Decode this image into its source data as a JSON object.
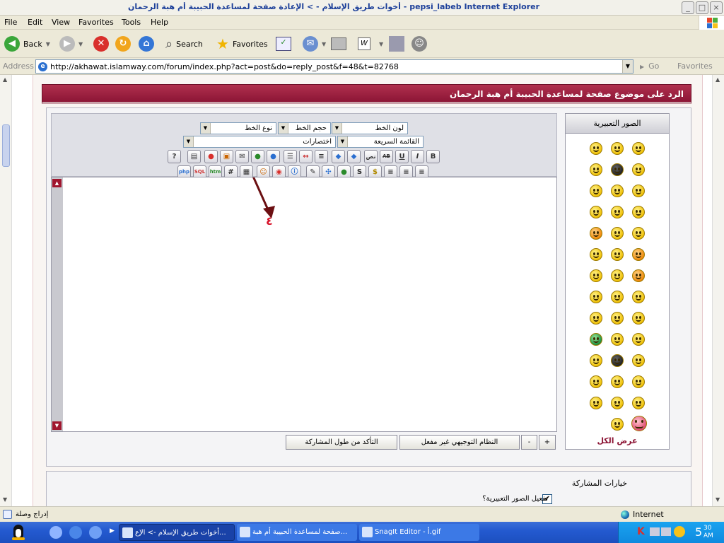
{
  "window": {
    "title": "أخوات طريق الإسلام - > الإعادة صفحة لمساعدة الحبيبة أم هبة الرحمان - pepsi_labeb Internet Explorer"
  },
  "menu": [
    "File",
    "Edit",
    "View",
    "Favorites",
    "Tools",
    "Help"
  ],
  "toolbar": {
    "back": "Back",
    "search": "Search",
    "favorites": "Favorites"
  },
  "address": {
    "label": "Address",
    "url": "http://akhawat.islamway.com/forum/index.php?act=post&do=reply_post&f=48&t=82768",
    "go": "Go",
    "favorites": "Favorites"
  },
  "forum": {
    "title": "الرد على موضوع صفحة لمساعدة الحبيبة أم هبة الرحمان"
  },
  "editor": {
    "selects": {
      "font_color": "لون الخط",
      "font_size": "حجم الخط",
      "font_type": "نوع الخط",
      "quick_list": "القائمة السريعة",
      "shortcuts": "اختصارات"
    },
    "row1_buttons": [
      "B",
      "I",
      "U",
      "AB",
      "نص",
      "",
      "",
      "",
      "",
      "",
      "",
      "",
      "",
      "",
      "",
      "?"
    ],
    "row2_buttons": [
      "",
      "",
      "",
      "S",
      "",
      "",
      "",
      "",
      "",
      "",
      "",
      "#",
      "htm",
      "SQL",
      "php"
    ],
    "annotation_label": "٤",
    "buttons": {
      "plus": "+",
      "minus": "-",
      "guided_mode": "النظام التوجيهي غير مفعل",
      "check_length": "التأكد من طول المشاركة"
    }
  },
  "emoticons": {
    "header": "الصور التعبيرية",
    "show_all": "عرض الكل"
  },
  "options": {
    "header": "خيارات المشاركة",
    "enable_emoticons": "تفعيل الصور التعبيرية؟",
    "enable_emoticons_checked": "✔"
  },
  "status": {
    "text": "إدراج وصلة",
    "zone": "Internet"
  },
  "taskbar": {
    "tasks": [
      "أخوات طريق الإسلام -> الإع...",
      "صفحة لمساعدة الحبيبة أم هبة...",
      "SnagIt Editor - أ.gif"
    ],
    "clock_hour": "5",
    "clock_min": "30",
    "clock_ampm": "AM"
  },
  "colors": {
    "forum_header": "#8c1535",
    "annotation": "#d8132a",
    "taskbar": "#245ad0"
  }
}
